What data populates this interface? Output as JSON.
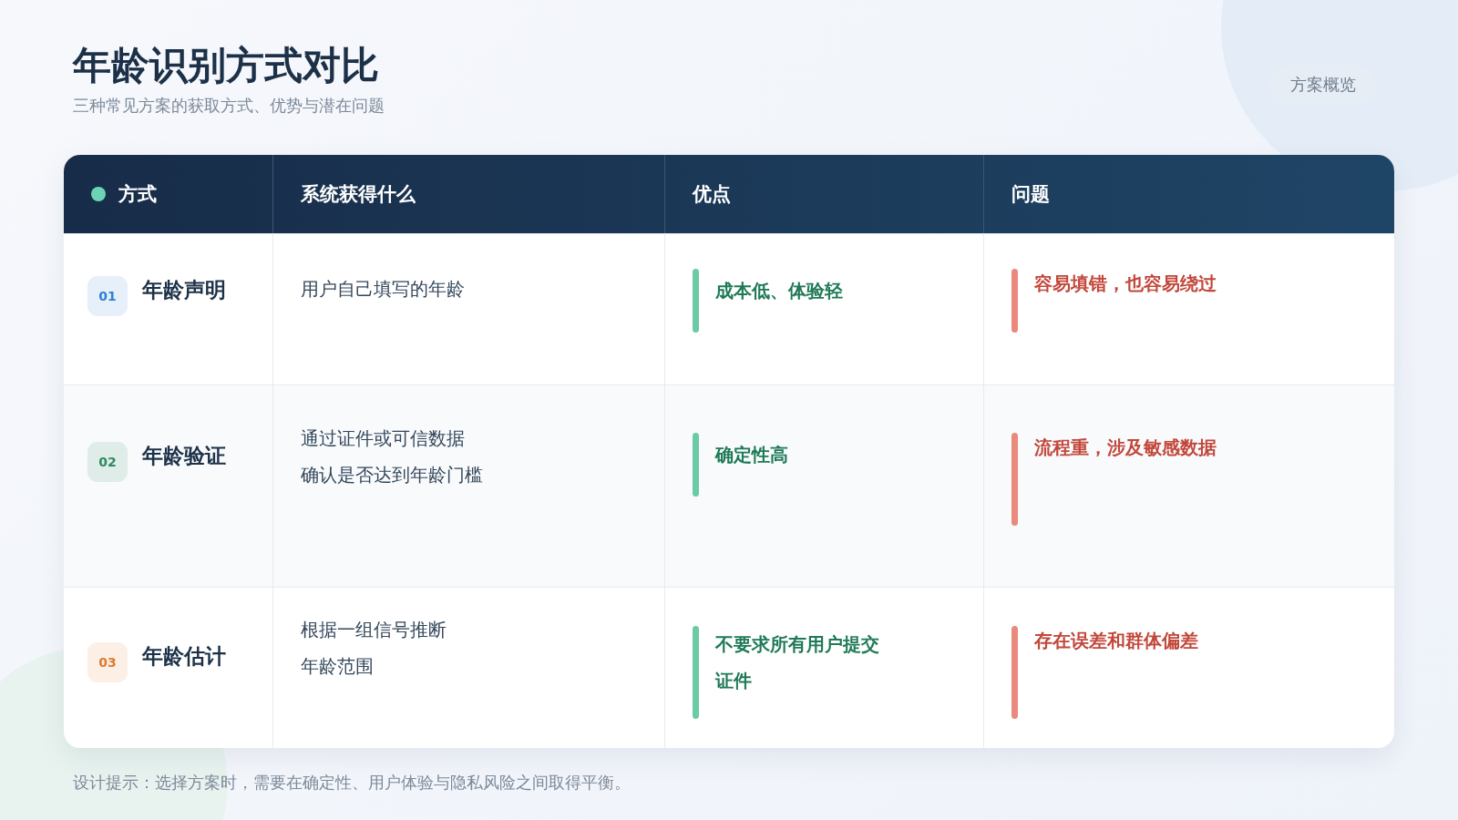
{
  "header": {
    "title": "年龄识别方式对比",
    "subtitle": "三种常见方案的获取方式、优势与潜在问题",
    "tag": "方案概览"
  },
  "table": {
    "columns": [
      "方式",
      "系统获得什么",
      "优点",
      "问题"
    ],
    "rows": [
      {
        "number": "01",
        "color": "#2f7fd6",
        "method": "年龄声明",
        "obtains": [
          "用户自己填写的年龄"
        ],
        "pro": [
          "成本低、体验轻"
        ],
        "con": [
          "容易填错，也容易绕过"
        ]
      },
      {
        "number": "02",
        "color": "#2e8a5e",
        "method": "年龄验证",
        "obtains": [
          "通过证件或可信数据",
          "确认是否达到年龄门槛"
        ],
        "pro": [
          "确定性高"
        ],
        "con": [
          "流程重，涉及敏感数据"
        ]
      },
      {
        "number": "03",
        "color": "#e07b2e",
        "method": "年龄估计",
        "obtains": [
          "根据一组信号推断",
          "年龄范围"
        ],
        "pro": [
          "不要求所有用户提交",
          "证件"
        ],
        "con": [
          "存在误差和群体偏差"
        ]
      }
    ]
  },
  "footer": "设计提示：选择方案时，需要在确定性、用户体验与隐私风险之间取得平衡。"
}
